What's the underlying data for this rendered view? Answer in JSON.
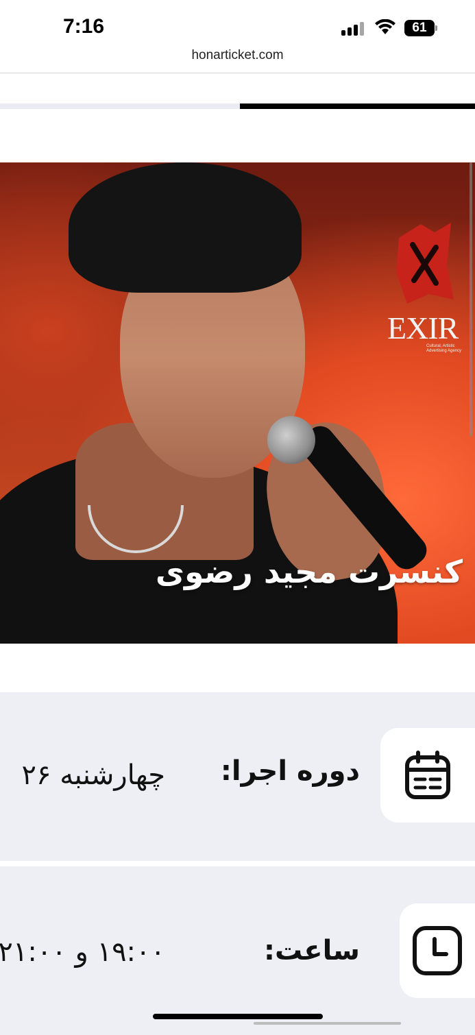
{
  "status_bar": {
    "time": "7:16",
    "battery": "61"
  },
  "browser": {
    "url": "honarticket.com"
  },
  "hero": {
    "title": "کنسرت مجید رضوی",
    "logo": "EXIR",
    "logo_subtitle": "Cultural, Artistic Advertising Agency",
    "accent_color": "#d0532a"
  },
  "info": {
    "date_label": "دوره اجرا:",
    "date_value": "چهارشنبه ۲۶",
    "time_label": "ساعت:",
    "time_value": "۱۹:۰۰ و ۲۱:۰۰"
  },
  "icons": {
    "calendar": "calendar-icon",
    "clock": "clock-icon"
  }
}
